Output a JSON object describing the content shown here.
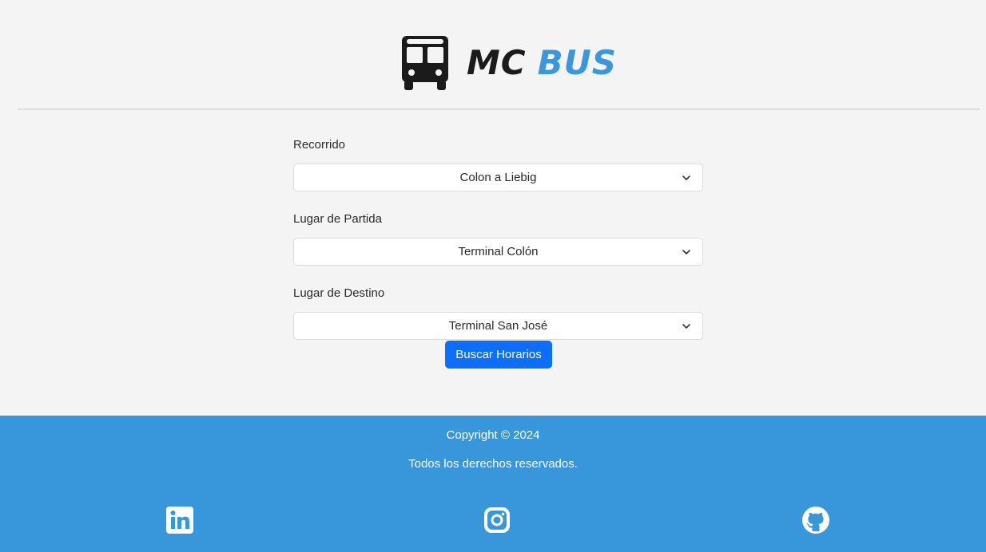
{
  "brand": {
    "icon": "bus-icon",
    "name_part1": "MC",
    "name_part2": "BUS",
    "accent_color": "#3a97dc"
  },
  "form": {
    "recorrido": {
      "label": "Recorrido",
      "selected": "Colon a Liebig"
    },
    "partida": {
      "label": "Lugar de Partida",
      "selected": "Terminal Colón"
    },
    "destino": {
      "label": "Lugar de Destino",
      "selected": "Terminal San José"
    },
    "submit_label": "Buscar Horarios",
    "button_color": "#0d6efd"
  },
  "footer": {
    "copyright": "Copyright © 2024",
    "rights": "Todos los derechos reservados.",
    "background": "#3897db",
    "social": [
      {
        "icon": "linkedin-icon"
      },
      {
        "icon": "instagram-icon"
      },
      {
        "icon": "github-icon"
      }
    ]
  }
}
